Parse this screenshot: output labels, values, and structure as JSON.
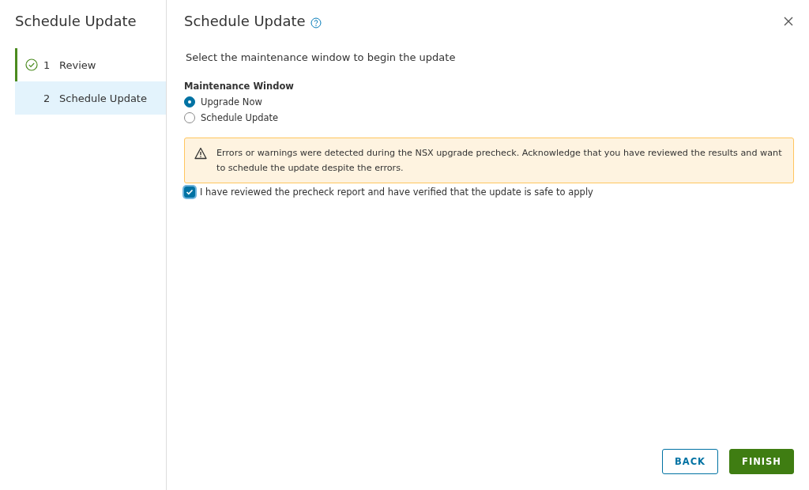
{
  "sidebar": {
    "title": "Schedule Update",
    "steps": [
      {
        "number": "1",
        "label": "Review",
        "completed": true,
        "selected": false
      },
      {
        "number": "2",
        "label": "Schedule Update",
        "completed": false,
        "selected": true
      }
    ]
  },
  "dialog": {
    "title": "Schedule Update",
    "instruction": "Select the maintenance window to begin the update",
    "group_label": "Maintenance Window",
    "options": [
      {
        "label": "Upgrade Now",
        "selected": true
      },
      {
        "label": "Schedule Update",
        "selected": false
      }
    ],
    "alert": {
      "kind": "warning",
      "text": "Errors or warnings were detected during the NSX upgrade precheck. Acknowledge that you have reviewed the results and want to schedule the update despite the errors."
    },
    "acknowledge": {
      "label": "I have reviewed the precheck report and have verified that the update is safe to apply",
      "checked": true
    },
    "buttons": [
      {
        "label": "BACK",
        "kind": "outline"
      },
      {
        "label": "FINISH",
        "kind": "primary"
      }
    ]
  }
}
